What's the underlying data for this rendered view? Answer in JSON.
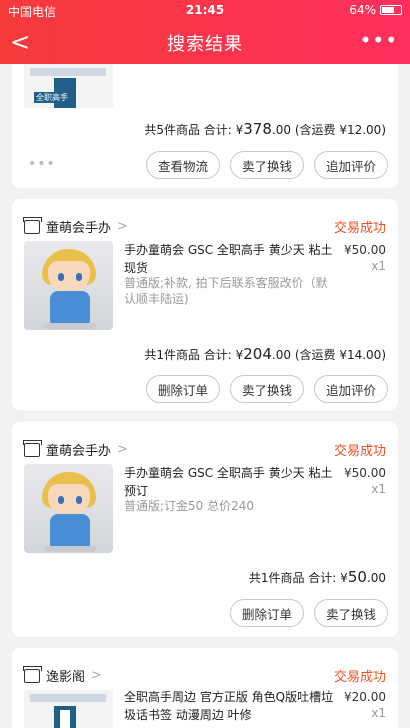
{
  "status_bar": {
    "carrier": "中国电信",
    "time": "21:45",
    "battery": "64%"
  },
  "nav": {
    "title": "搜索结果",
    "back": "<",
    "more": "•••"
  },
  "top_card": {
    "summary_label": "共5件商品 合计: ¥",
    "amount": "378",
    "decimals": ".00",
    "shipping": "(含运费 ¥12.00)",
    "thumb_text": "全职高手",
    "buttons": [
      "查看物流",
      "卖了换钱",
      "追加评价"
    ]
  },
  "orders": [
    {
      "shop": "童萌会手办",
      "status": "交易成功",
      "title": "手办童萌会 GSC 全职高手 黄少天 粘土 现货",
      "spec": "普通版;补款, 拍下后联系客服改价（默认顺丰陆运)",
      "price": "¥50.00",
      "qty": "x1",
      "summary_label": "共1件商品 合计: ¥",
      "amount": "204",
      "decimals": ".00",
      "shipping": "(含运费 ¥14.00)",
      "buttons": [
        "删除订单",
        "卖了换钱",
        "追加评价"
      ]
    },
    {
      "shop": "童萌会手办",
      "status": "交易成功",
      "title": "手办童萌会 GSC 全职高手 黄少天 粘土 预订",
      "spec": "普通版;订金50 总价240",
      "price": "¥50.00",
      "qty": "x1",
      "summary_label": "共1件商品 合计: ¥",
      "amount": "50",
      "decimals": ".00",
      "shipping": "",
      "buttons": [
        "删除订单",
        "卖了换钱"
      ]
    },
    {
      "shop": "逸影阁",
      "status": "交易成功",
      "title": "全职高手周边 官方正版 角色Q版吐槽垃圾话书签 动漫周边 叶修",
      "spec": "",
      "price": "¥20.00",
      "qty": "x1"
    }
  ]
}
